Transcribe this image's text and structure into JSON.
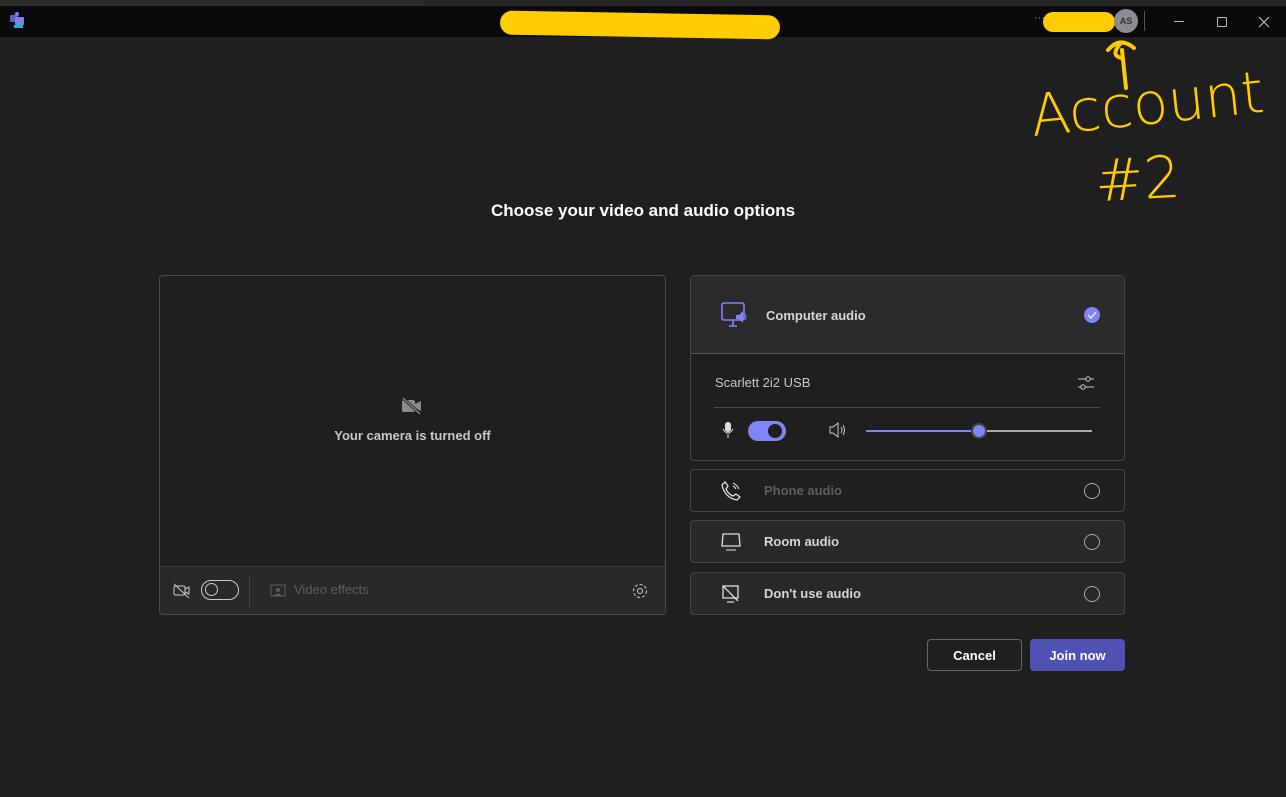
{
  "titlebar": {
    "avatar_initials": "AS",
    "more_label": "···"
  },
  "annotation": {
    "line1": "Account",
    "line2": "#2"
  },
  "heading": "Choose your video and audio options",
  "video": {
    "status": "Your camera is turned off",
    "camera_toggle_on": false,
    "effects_label": "Video effects"
  },
  "audio": {
    "computer": {
      "label": "Computer audio",
      "selected": true,
      "device": "Scarlett 2i2 USB",
      "mic_on": true,
      "volume": 0.5
    },
    "options": [
      {
        "label": "Phone audio",
        "disabled": true
      },
      {
        "label": "Room audio",
        "disabled": false
      },
      {
        "label": "Don't use audio",
        "disabled": false
      }
    ]
  },
  "buttons": {
    "cancel": "Cancel",
    "join": "Join now"
  },
  "colors": {
    "accent": "#7f85f5",
    "primary": "#4f52b2",
    "annotation": "#ffcc00"
  }
}
